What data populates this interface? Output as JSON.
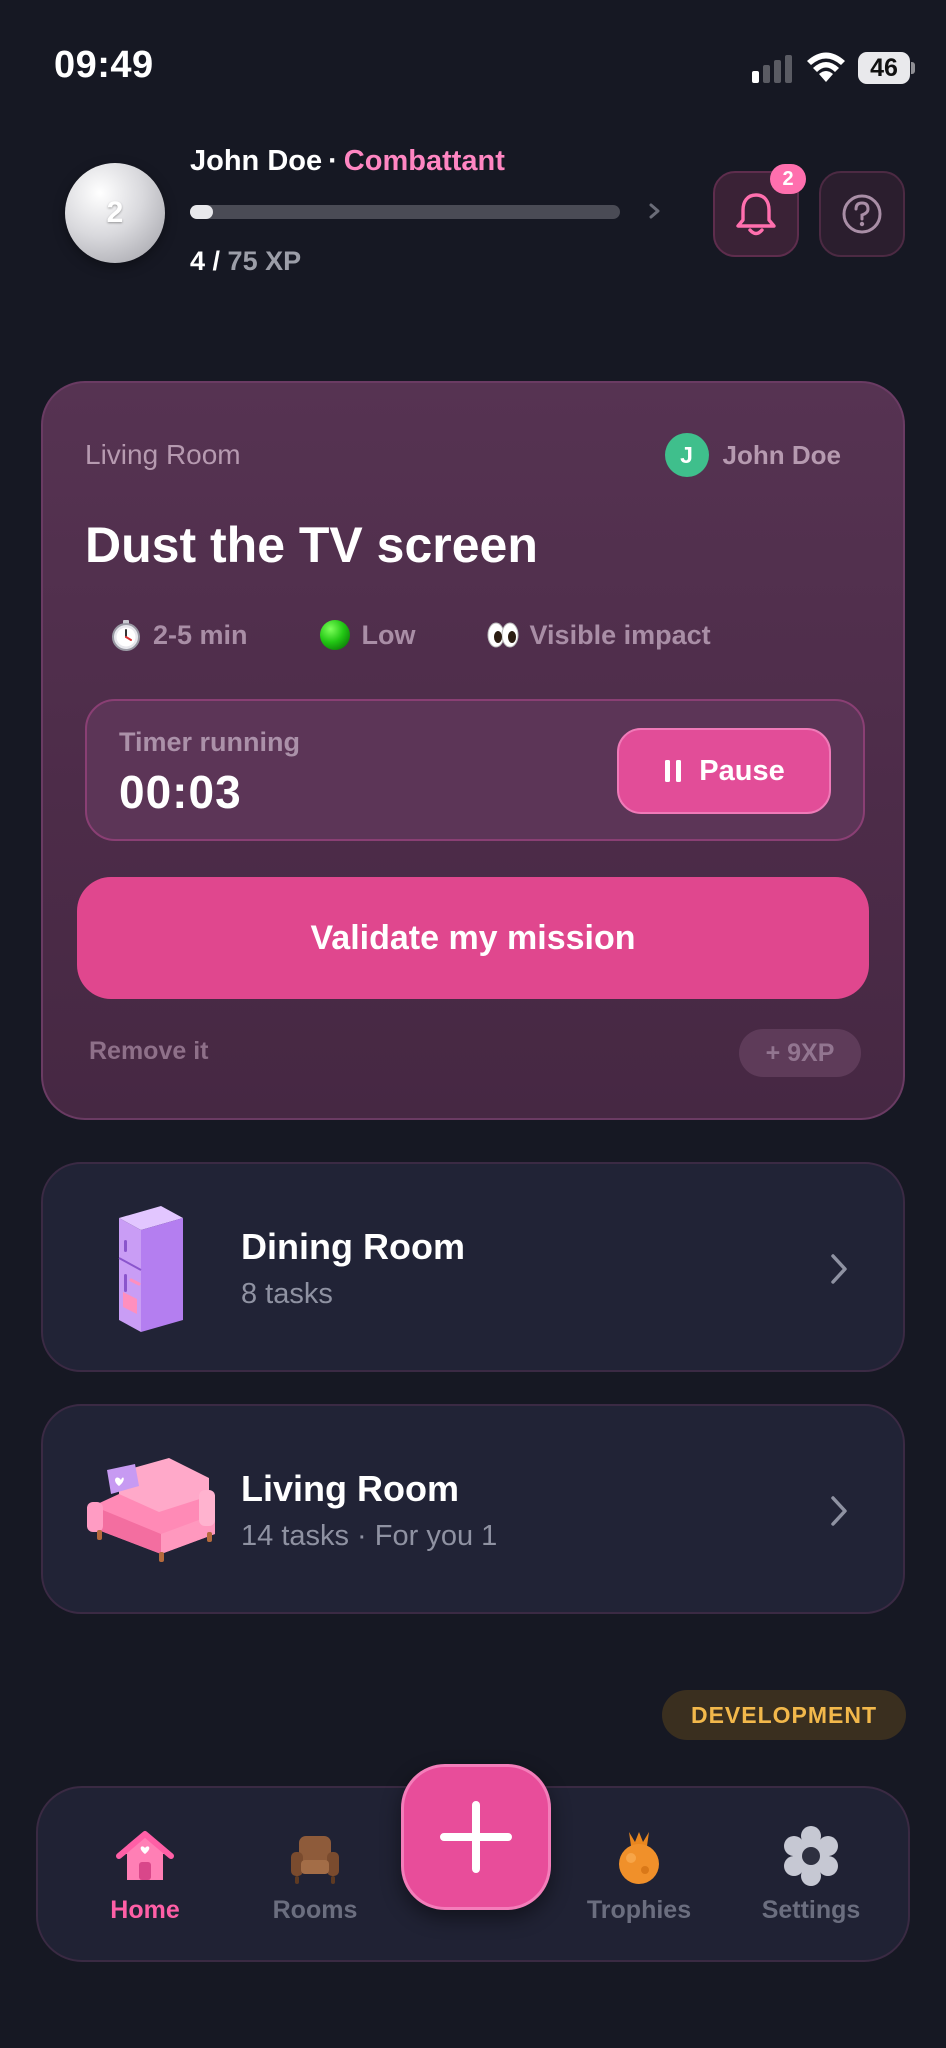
{
  "status_bar": {
    "time": "09:49",
    "battery": "46"
  },
  "header": {
    "avatar_level": "2",
    "user_name": "John Doe",
    "separator": "·",
    "rank": "Combattant",
    "xp_current": "4",
    "xp_separator": " / ",
    "xp_total": "75 XP",
    "xp_progress": 0.053,
    "notification_count": "2"
  },
  "mission": {
    "room": "Living Room",
    "assignee_initial": "J",
    "assignee_name": "John Doe",
    "title": "Dust the TV screen",
    "meta": [
      {
        "icon": "stopwatch-icon",
        "text": "2-5 min"
      },
      {
        "icon": "green-circle-icon",
        "text": "Low"
      },
      {
        "icon": "eyes-icon",
        "text": "Visible impact"
      }
    ],
    "timer_label": "Timer running",
    "timer_value": "00:03",
    "pause_label": "Pause",
    "validate_label": "Validate my mission",
    "remove_label": "Remove it",
    "xp_reward": "+ 9XP"
  },
  "rooms": [
    {
      "name": "Dining Room",
      "subtitle": "8 tasks",
      "icon": "fridge-icon"
    },
    {
      "name": "Living Room",
      "subtitle": "14 tasks · For you 1",
      "icon": "sofa-icon"
    }
  ],
  "dev_badge": "DEVELOPMENT",
  "nav": {
    "home": "Home",
    "rooms": "Rooms",
    "trophies": "Trophies",
    "settings": "Settings"
  },
  "colors": {
    "background": "#161823",
    "accent": "#e24d98",
    "rank": "#ff86c2",
    "card": "#4d2c49",
    "room_card": "#212336",
    "dev": "#f2b84b"
  }
}
